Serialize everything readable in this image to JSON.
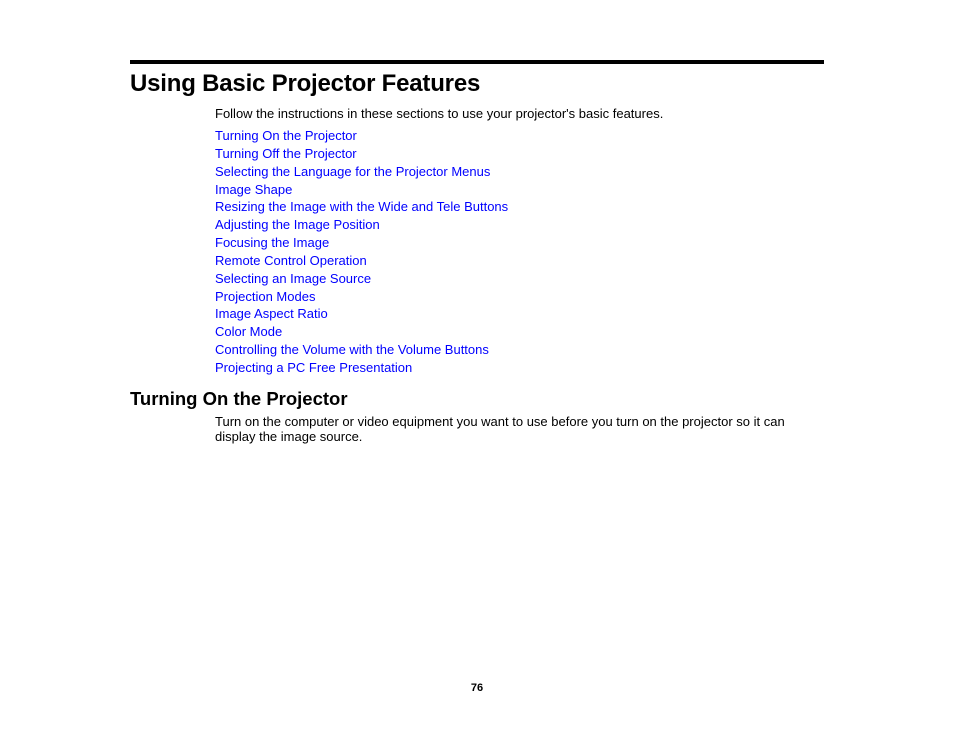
{
  "page": {
    "title": "Using Basic Projector Features",
    "intro": "Follow the instructions in these sections to use your projector's basic features.",
    "links": [
      {
        "label": "Turning On the Projector"
      },
      {
        "label": "Turning Off the Projector"
      },
      {
        "label": "Selecting the Language for the Projector Menus"
      },
      {
        "label": "Image Shape"
      },
      {
        "label": "Resizing the Image with the Wide and Tele Buttons"
      },
      {
        "label": "Adjusting the Image Position"
      },
      {
        "label": "Focusing the Image"
      },
      {
        "label": "Remote Control Operation"
      },
      {
        "label": "Selecting an Image Source"
      },
      {
        "label": "Projection Modes"
      },
      {
        "label": "Image Aspect Ratio"
      },
      {
        "label": "Color Mode"
      },
      {
        "label": "Controlling the Volume with the Volume Buttons"
      },
      {
        "label": "Projecting a PC Free Presentation"
      }
    ],
    "section": {
      "heading": "Turning On the Projector",
      "body": "Turn on the computer or video equipment you want to use before you turn on the projector so it can display the image source."
    },
    "page_number": "76"
  },
  "colors": {
    "link": "#0000ff",
    "text": "#000000",
    "rule": "#000000"
  }
}
